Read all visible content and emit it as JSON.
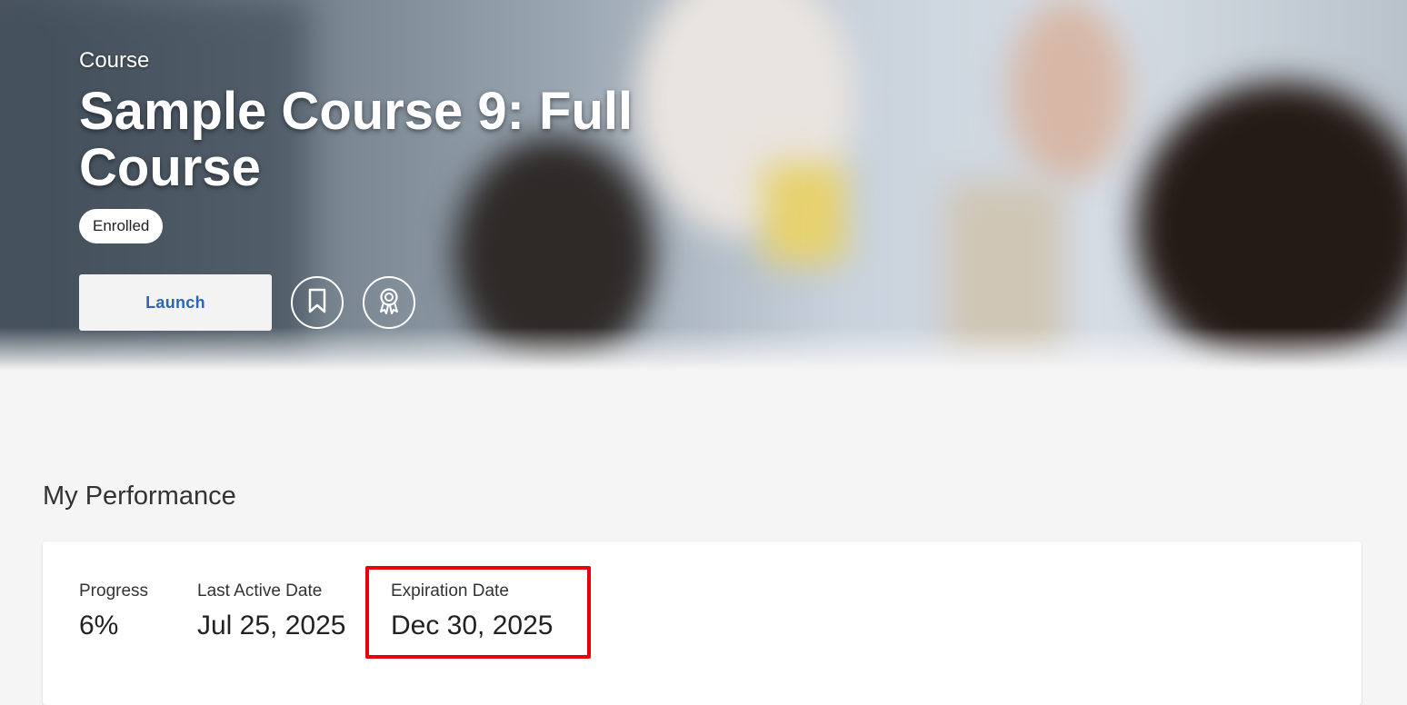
{
  "hero": {
    "type_label": "Course",
    "title": "Sample Course 9: Full Course",
    "status_badge": "Enrolled",
    "launch_label": "Launch"
  },
  "icons": {
    "bookmark": "bookmark-icon",
    "certificate": "certificate-icon"
  },
  "performance": {
    "heading": "My Performance",
    "stats": [
      {
        "label": "Progress",
        "value": "6%"
      },
      {
        "label": "Last Active Date",
        "value": "Jul 25, 2025"
      },
      {
        "label": "Expiration Date",
        "value": "Dec 30, 2025"
      }
    ]
  },
  "colors": {
    "accent": "#2a66b5",
    "highlight": "#e8000b",
    "page_bg": "#f5f5f5"
  }
}
